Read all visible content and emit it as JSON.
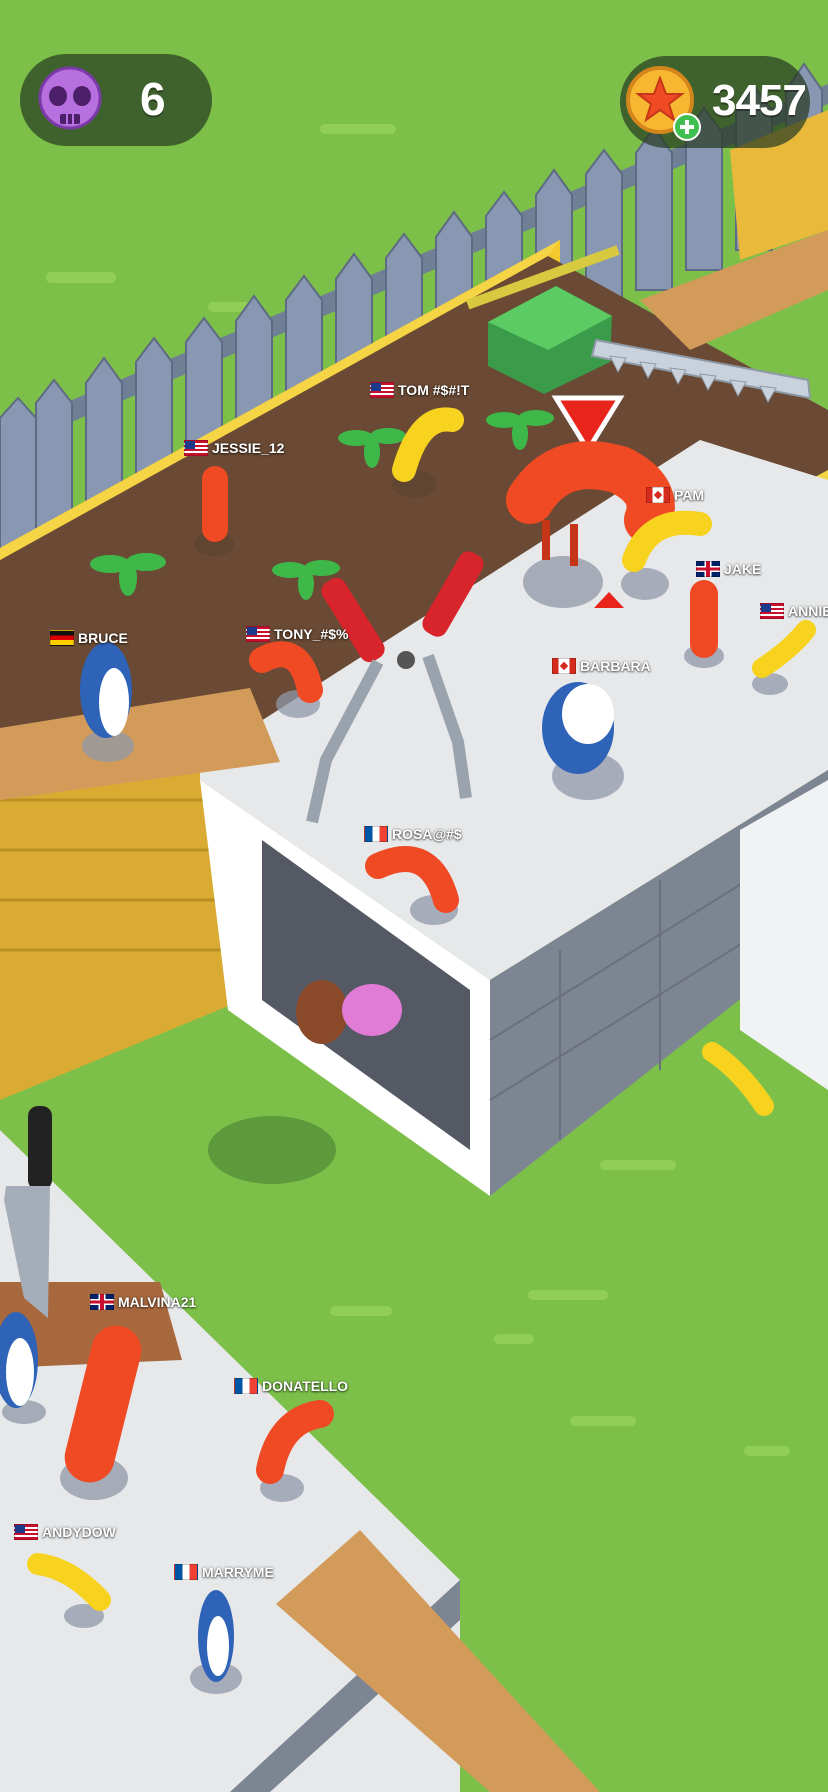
{
  "hud": {
    "kills": {
      "icon": "skull-icon",
      "value": "6"
    },
    "coins": {
      "icon": "star-coin-icon",
      "badge_icon": "plus-icon",
      "value": "3457"
    }
  },
  "colors": {
    "grass": "#7cc04a",
    "hud_pill": "#283c23",
    "skull": "#b86fe0",
    "coin": "#f7b731",
    "plus_badge": "#3fbf4f",
    "target_marker": "#e8241b",
    "sausage_red": "#ef4a24",
    "banana_yellow": "#f7d31f",
    "shark_blue": "#2e63b7"
  },
  "players": [
    {
      "id": "tom",
      "name": "TOM #$#!T",
      "flag": "us"
    },
    {
      "id": "jessie",
      "name": "JESSIE_12",
      "flag": "us"
    },
    {
      "id": "pam",
      "name": "PAM",
      "flag": "ca"
    },
    {
      "id": "jake",
      "name": "JAKE",
      "flag": "gb"
    },
    {
      "id": "annie",
      "name": "ANNIE",
      "flag": "us"
    },
    {
      "id": "bruce",
      "name": "BRUCE",
      "flag": "de"
    },
    {
      "id": "tony",
      "name": "TONY_#$%",
      "flag": "us"
    },
    {
      "id": "barbara",
      "name": "BARBARA",
      "flag": "ca"
    },
    {
      "id": "rosa",
      "name": "ROSA@#$",
      "flag": "fr"
    },
    {
      "id": "malvina",
      "name": "MALVINA21",
      "flag": "gb"
    },
    {
      "id": "donatello",
      "name": "DONATELLO",
      "flag": "fr"
    },
    {
      "id": "andydow",
      "name": "ANDYDOW",
      "flag": "us"
    },
    {
      "id": "marryme",
      "name": "MARRYME",
      "flag": "fr"
    }
  ]
}
